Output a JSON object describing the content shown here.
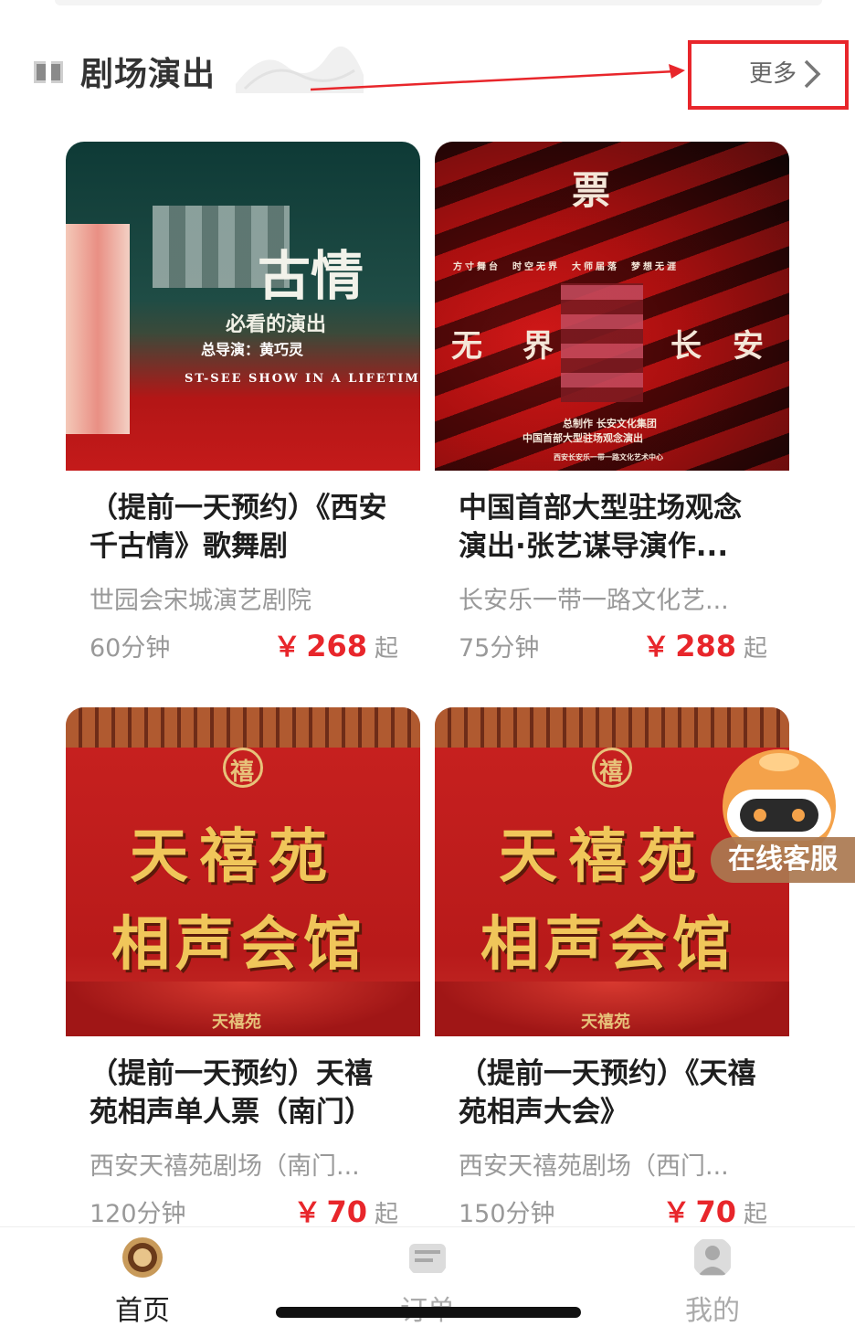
{
  "section": {
    "title": "剧场演出",
    "more_label": "更多"
  },
  "cards": [
    {
      "title": "（提前一天预约）《西安千古情》歌舞剧",
      "venue": "世园会宋城演艺剧院",
      "duration": "60分钟",
      "currency": "￥",
      "price": "268",
      "price_suffix": "起",
      "poster": {
        "main_text": "古情",
        "sub_text": "必看的演出",
        "director": "总导演：黄巧灵",
        "english": "ST-SEE SHOW IN A LIFETIME"
      }
    },
    {
      "title": "中国首部大型驻场观念演出·张艺谋导演作...",
      "venue": "长安乐一带一路文化艺...",
      "duration": "75分钟",
      "currency": "￥",
      "price": "288",
      "price_suffix": "起",
      "poster": {
        "logo": "票",
        "tagline": "方寸舞台　时空无界　大师届落　梦想无涯",
        "main_left": "无",
        "main_mid": "界",
        "main_right": "长　安",
        "credit1": "总制作 长安文化集团",
        "credit2": "中国首部大型驻场观念演出",
        "credit3": "西安长安乐一带一路文化艺术中心"
      }
    },
    {
      "title": "（提前一天预约）天禧苑相声单人票（南门）",
      "venue": "西安天禧苑剧场（南门...",
      "duration": "120分钟",
      "currency": "￥",
      "price": "70",
      "price_suffix": "起",
      "poster": {
        "seal": "禧",
        "line1": "天禧苑",
        "line2": "相声会馆",
        "footer": "天禧苑"
      }
    },
    {
      "title": "（提前一天预约）《天禧苑相声大会》",
      "venue": "西安天禧苑剧场（西门...",
      "duration": "150分钟",
      "currency": "￥",
      "price": "70",
      "price_suffix": "起",
      "poster": {
        "seal": "禧",
        "line1": "天禧苑",
        "line2": "相声会馆",
        "footer": "天禧苑"
      }
    }
  ],
  "chat_widget": {
    "label": "在线客服"
  },
  "nav": {
    "items": [
      {
        "label": "首页",
        "icon": "home-logo-icon",
        "active": true
      },
      {
        "label": "订单",
        "icon": "order-icon",
        "active": false
      },
      {
        "label": "我的",
        "icon": "profile-icon",
        "active": false
      }
    ]
  },
  "colors": {
    "accent": "#e8262b",
    "muted": "#999999",
    "title": "#1e1e1e"
  }
}
